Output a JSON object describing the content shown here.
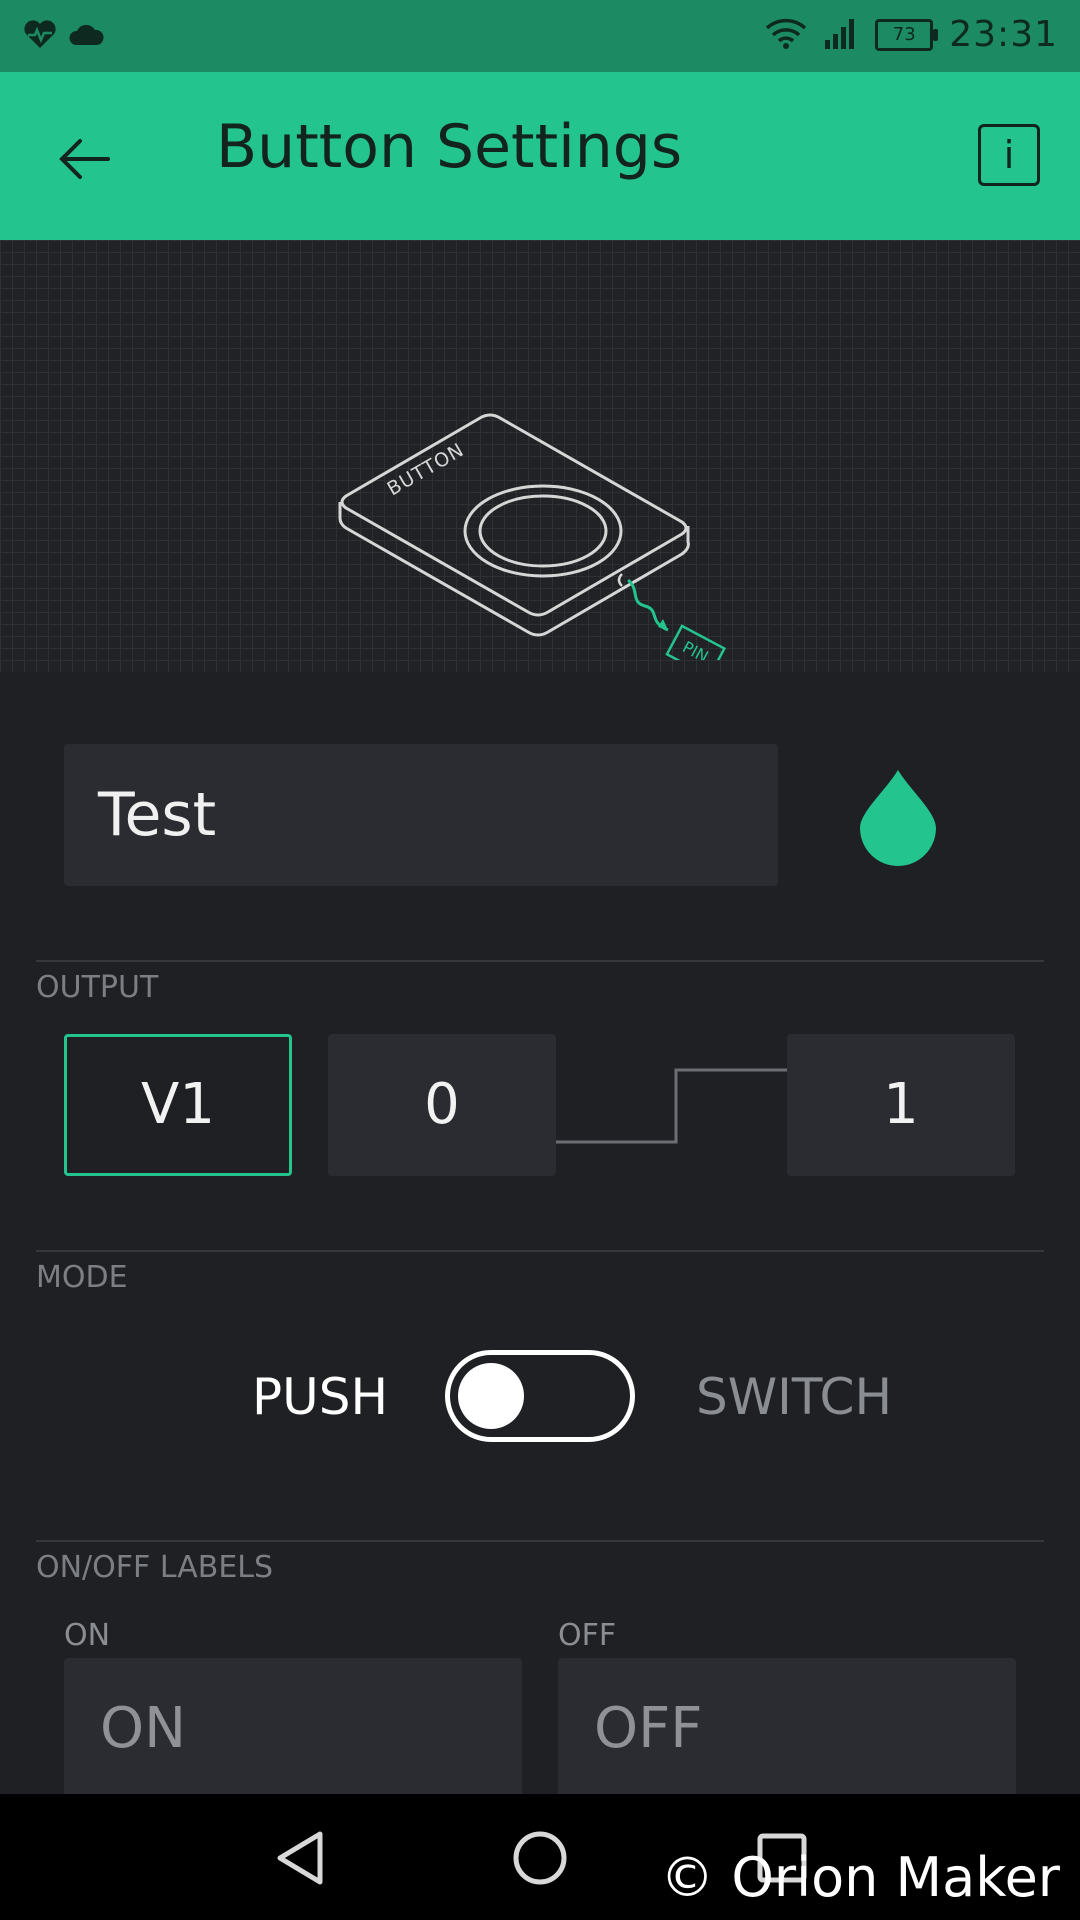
{
  "status_bar": {
    "icons_left": [
      "heart-pulse-icon",
      "cloud-icon"
    ],
    "icons_right": [
      "wifi-icon",
      "signal-icon"
    ],
    "battery": "73",
    "time": "23:31",
    "colors": {
      "background": "#1c8a63"
    }
  },
  "app_bar": {
    "title": "Button Settings",
    "back_icon": "arrow-left-icon",
    "info_label": "i",
    "colors": {
      "background": "#23c48e",
      "foreground": "#12241d"
    }
  },
  "hero": {
    "device_label": "BUTTON",
    "pin_label": "PIN"
  },
  "widget": {
    "name_value": "Test",
    "color_icon": "color-drop-icon",
    "accent": "#23c48e"
  },
  "output": {
    "section_label": "OUTPUT",
    "pin": "V1",
    "low_value": "0",
    "high_value": "1"
  },
  "mode": {
    "section_label": "MODE",
    "left_label": "PUSH",
    "right_label": "SWITCH",
    "state": "push"
  },
  "labels": {
    "section_label": "ON/OFF LABELS",
    "on_caption": "ON",
    "off_caption": "OFF",
    "on_placeholder": "ON",
    "off_placeholder": "OFF"
  },
  "nav_bar": {
    "icons": [
      "back-triangle-icon",
      "home-circle-icon",
      "recents-square-icon"
    ]
  },
  "watermark": "© Orion Maker"
}
